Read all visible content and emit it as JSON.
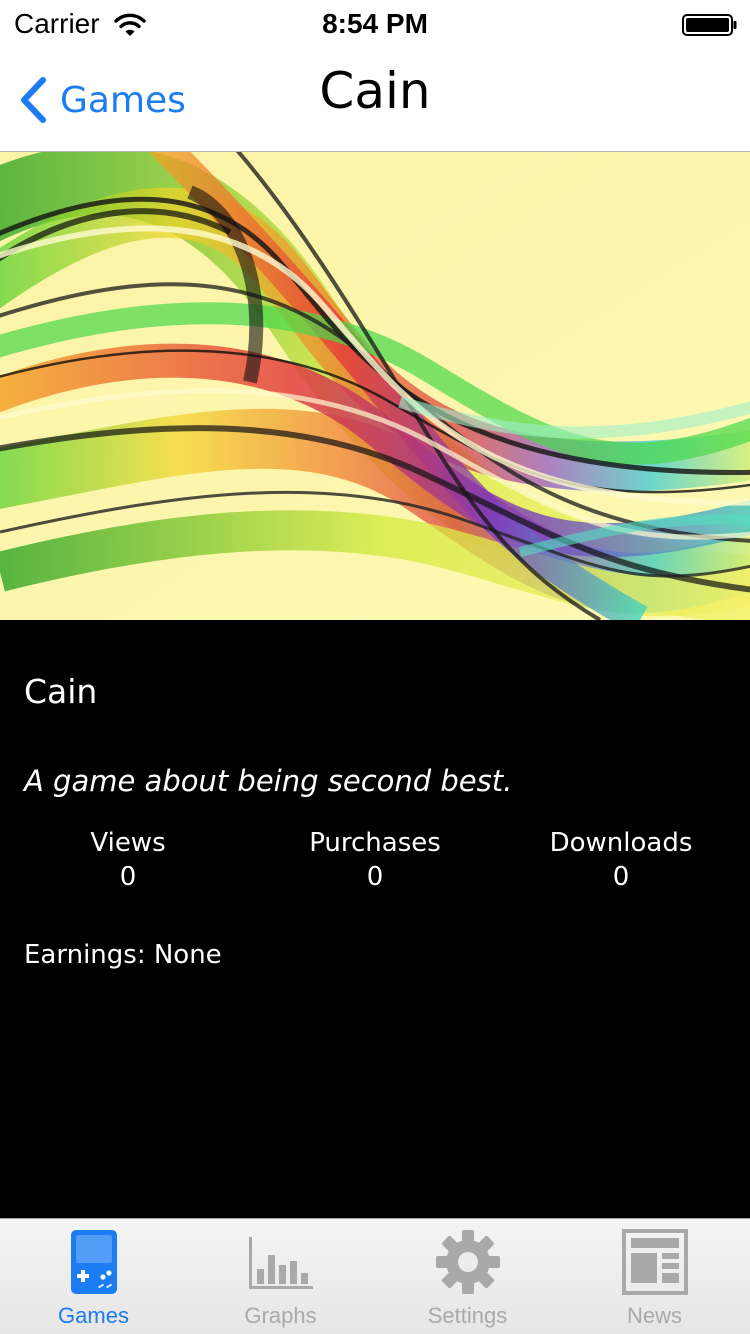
{
  "status_bar": {
    "carrier": "Carrier",
    "time": "8:54 PM"
  },
  "nav": {
    "back_label": "Games",
    "title": "Cain"
  },
  "game": {
    "name": "Cain",
    "tagline": "A game about being second best.",
    "stats": [
      {
        "label": "Views",
        "value": "0"
      },
      {
        "label": "Purchases",
        "value": "0"
      },
      {
        "label": "Downloads",
        "value": "0"
      }
    ],
    "earnings": "Earnings: None"
  },
  "tabs": [
    {
      "label": "Games",
      "icon": "game-console-icon",
      "active": true
    },
    {
      "label": "Graphs",
      "icon": "bar-chart-icon",
      "active": false
    },
    {
      "label": "Settings",
      "icon": "gear-icon",
      "active": false
    },
    {
      "label": "News",
      "icon": "newspaper-icon",
      "active": false
    }
  ],
  "colors": {
    "accent": "#1b7cf3",
    "inactive_tab": "#a9a9a9",
    "details_background": "#000000"
  }
}
